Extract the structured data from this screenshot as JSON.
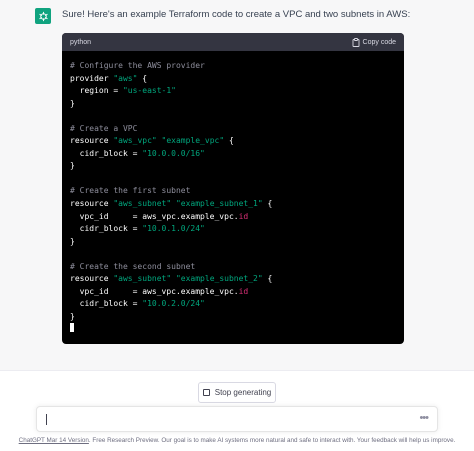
{
  "message": {
    "avatar_icon": "openai-logo-icon",
    "accent_color": "#10a37f",
    "intro": "Sure! Here's an example Terraform code to create a VPC and two subnets in AWS:"
  },
  "code_block": {
    "language": "python",
    "copy_label": "Copy code",
    "copy_icon": "clipboard-icon",
    "lines": [
      {
        "c": "# Configure the AWS provider"
      },
      {
        "k": "provider ",
        "s": "\"aws\"",
        "k2": " {"
      },
      {
        "k": "  region = ",
        "s": "\"us-east-1\""
      },
      {
        "k": "}"
      },
      {},
      {
        "c": "# Create a VPC"
      },
      {
        "k": "resource ",
        "s": "\"aws_vpc\" \"example_vpc\"",
        "k2": " {"
      },
      {
        "k": "  cidr_block = ",
        "s": "\"10.0.0.0/16\""
      },
      {
        "k": "}"
      },
      {},
      {
        "c": "# Create the first subnet"
      },
      {
        "k": "resource ",
        "s": "\"aws_subnet\" \"example_subnet_1\"",
        "k2": " {"
      },
      {
        "k": "  vpc_id     = aws_vpc.example_vpc.",
        "id": "id"
      },
      {
        "k": "  cidr_block = ",
        "s": "\"10.0.1.0/24\""
      },
      {
        "k": "}"
      },
      {},
      {
        "c": "# Create the second subnet"
      },
      {
        "k": "resource ",
        "s": "\"aws_subnet\" \"example_subnet_2\"",
        "k2": " {"
      },
      {
        "k": "  vpc_id     = aws_vpc.example_vpc.",
        "id": "id"
      },
      {
        "k": "  cidr_block = ",
        "s": "\"10.0.2.0/24\""
      },
      {
        "k": "}"
      }
    ]
  },
  "controls": {
    "stop_label": "Stop generating",
    "stop_icon": "stop-square-icon"
  },
  "prompt": {
    "value": "",
    "more_icon": "ellipsis-icon"
  },
  "footer": {
    "link_text": "ChatGPT Mar 14 Version",
    "text": ". Free Research Preview. Our goal is to make AI systems more natural and safe to interact with. Your feedback will help us improve."
  }
}
